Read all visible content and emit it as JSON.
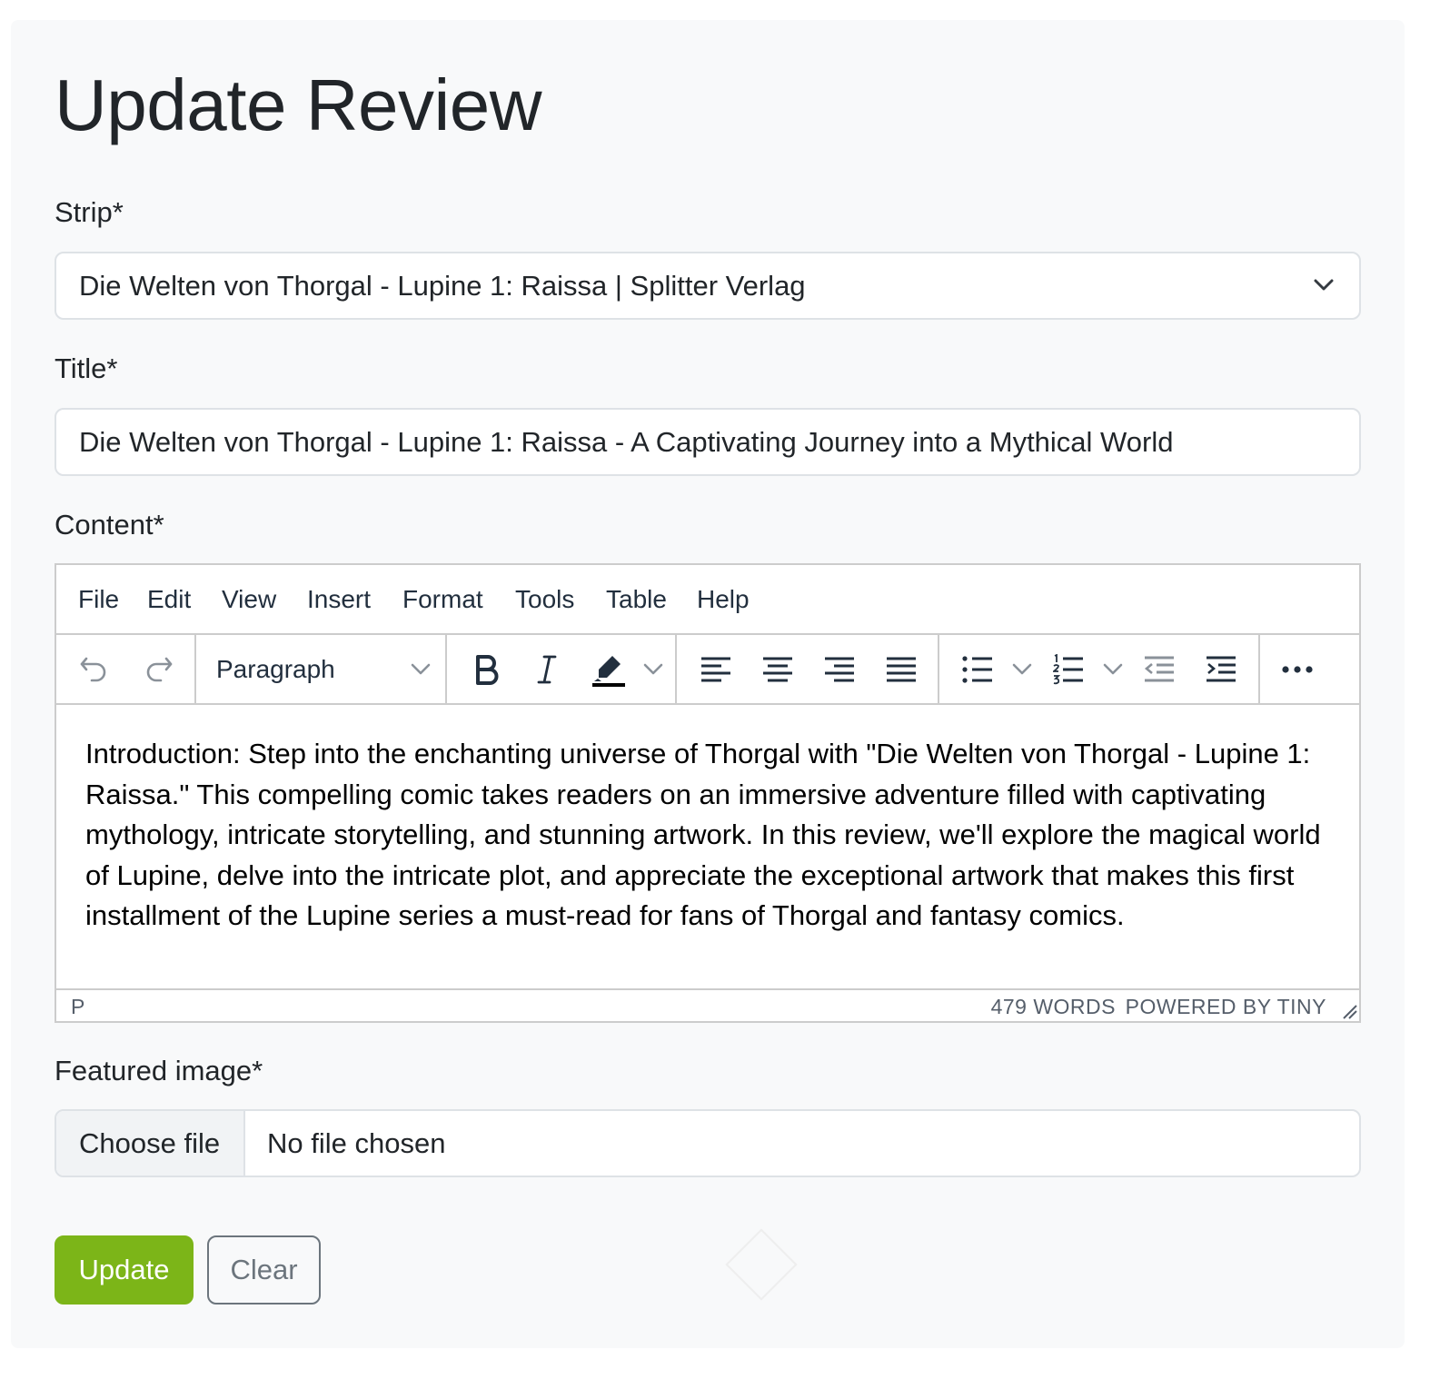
{
  "page": {
    "title": "Update Review"
  },
  "form": {
    "strip": {
      "label": "Strip*",
      "selected": "Die Welten von Thorgal - Lupine 1: Raissa | Splitter Verlag"
    },
    "title": {
      "label": "Title*",
      "value": "Die Welten von Thorgal - Lupine 1: Raissa - A Captivating Journey into a Mythical World"
    },
    "content": {
      "label": "Content*",
      "menu": [
        "File",
        "Edit",
        "View",
        "Insert",
        "Format",
        "Tools",
        "Table",
        "Help"
      ],
      "block_format": "Paragraph",
      "body": "Introduction: Step into the enchanting universe of Thorgal with \"Die Welten von Thorgal - Lupine 1: Raissa.\" This compelling comic takes readers on an immersive adventure filled with captivating mythology, intricate storytelling, and stunning artwork. In this review, we'll explore the magical world of Lupine, delve into the intricate plot, and appreciate the exceptional artwork that makes this first installment of the Lupine series a must-read for fans of Thorgal and fantasy comics.",
      "status_path": "P",
      "word_count": "479 WORDS",
      "powered_by": "POWERED BY TINY"
    },
    "featured_image": {
      "label": "Featured image*",
      "button": "Choose file",
      "status": "No file chosen"
    },
    "buttons": {
      "update": "Update",
      "clear": "Clear"
    }
  },
  "colors": {
    "primary": "#7cb518",
    "secondary": "#6c757d",
    "background": "#f8f9fa"
  },
  "icons": [
    "chevron-down-icon",
    "undo-icon",
    "redo-icon",
    "bold-icon",
    "italic-icon",
    "highlight-icon",
    "align-left-icon",
    "align-center-icon",
    "align-right-icon",
    "justify-icon",
    "bullet-list-icon",
    "numbered-list-icon",
    "outdent-icon",
    "indent-icon",
    "more-icon",
    "resize-icon"
  ]
}
